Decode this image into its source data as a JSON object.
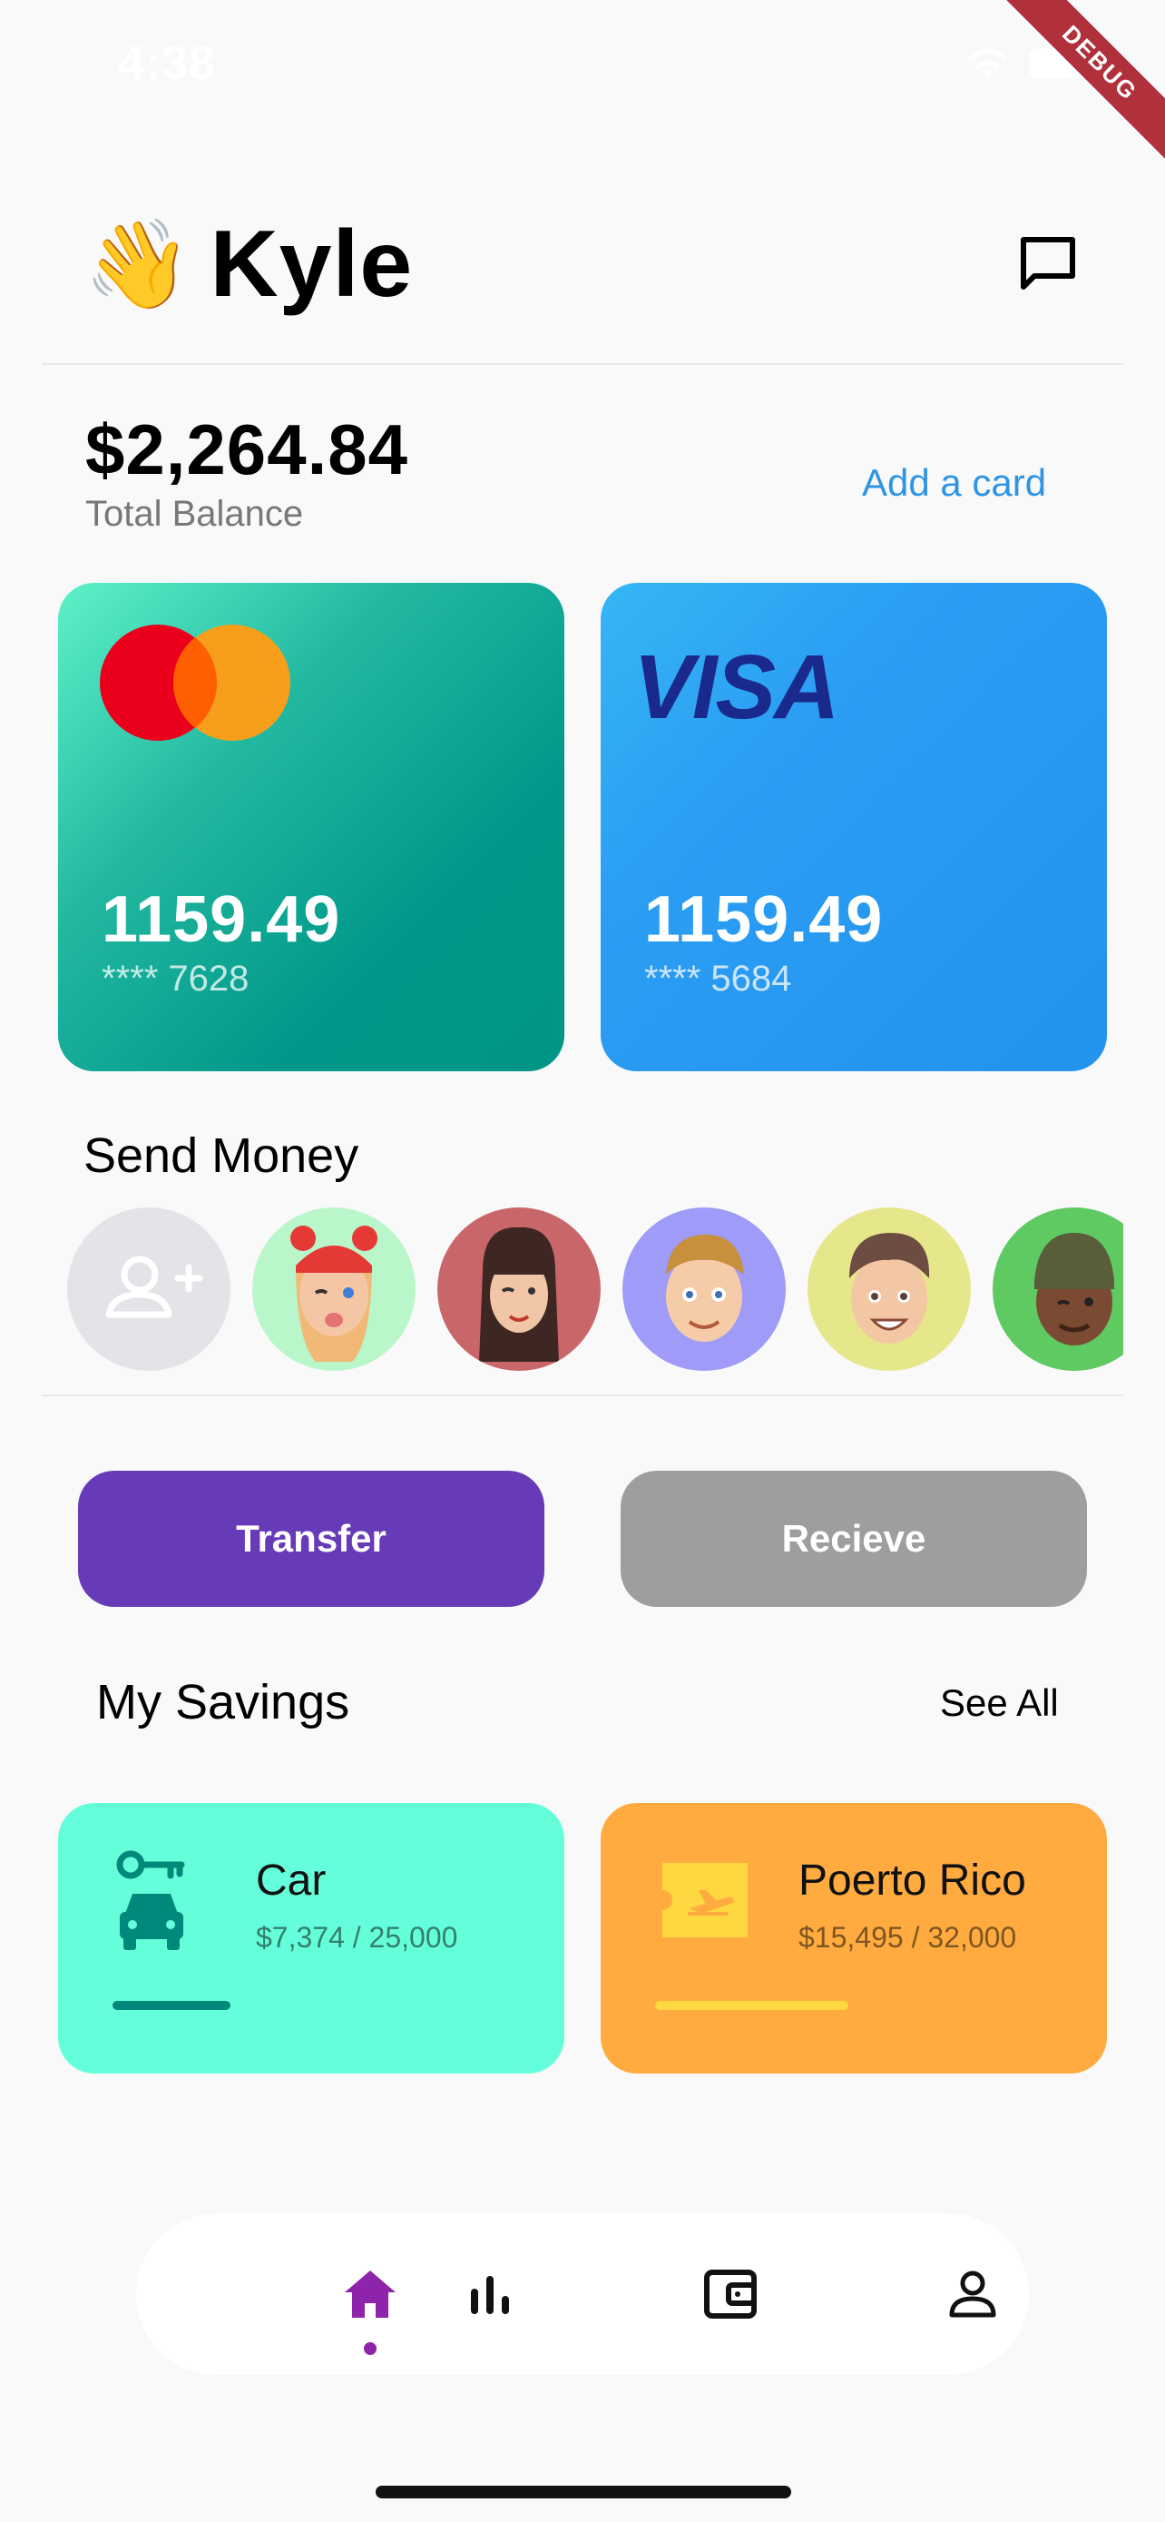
{
  "status_bar": {
    "time": "4:38",
    "debug_label": "DEBUG"
  },
  "header": {
    "wave_emoji": "👋",
    "name": "Kyle",
    "icon": "message-icon"
  },
  "balance": {
    "amount": "$2,264.84",
    "label": "Total Balance",
    "add_card_label": "Add a card"
  },
  "cards": [
    {
      "brand": "mastercard",
      "amount": "1159.49",
      "number": "**** 7628",
      "color": "#009688"
    },
    {
      "brand": "VISA",
      "amount": "1159.49",
      "number": "**** 5684",
      "color": "#2196f3"
    }
  ],
  "send_money": {
    "title": "Send Money",
    "add_icon": "add-person-icon",
    "contacts": [
      {
        "bg": "#b9f6ca",
        "desc": "avatar-girl-red-hat"
      },
      {
        "bg": "#c9666a",
        "desc": "avatar-woman-dark-hair"
      },
      {
        "bg": "#9e9cf8",
        "desc": "avatar-boy-blonde"
      },
      {
        "bg": "#e6e68a",
        "desc": "avatar-boy-brown-hair"
      },
      {
        "bg": "#5fc962",
        "desc": "avatar-man-beanie"
      }
    ]
  },
  "actions": {
    "transfer_label": "Transfer",
    "receive_label": "Recieve"
  },
  "savings": {
    "title": "My Savings",
    "see_all_label": "See All",
    "items": [
      {
        "name": "Car",
        "progress_text": "$7,374 / 25,000",
        "progress": 0.295,
        "color": "#64ffda",
        "accent": "#00897b",
        "icon": "car-key-icon"
      },
      {
        "name": "Poerto Rico",
        "progress_text": "$15,495 / 32,000",
        "progress": 0.484,
        "color": "#ffab40",
        "accent": "#ffd740",
        "icon": "flight-ticket-icon"
      }
    ]
  },
  "bottom_nav": {
    "items": [
      "home-icon",
      "stats-icon",
      "wallet-icon",
      "profile-icon"
    ],
    "active": 0,
    "active_color": "#8e24aa"
  }
}
